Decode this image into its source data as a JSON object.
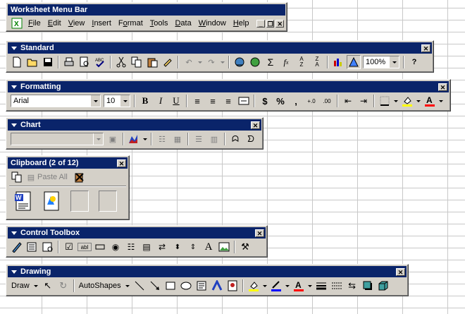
{
  "menu_bar": {
    "title": "Worksheet Menu Bar",
    "items": [
      "File",
      "Edit",
      "View",
      "Insert",
      "Format",
      "Tools",
      "Data",
      "Window",
      "Help"
    ],
    "mnemonics": [
      "F",
      "E",
      "V",
      "I",
      "o",
      "T",
      "D",
      "W",
      "H"
    ]
  },
  "standard": {
    "title": "Standard",
    "zoom": "100%"
  },
  "formatting": {
    "title": "Formatting",
    "font": "Arial",
    "size": "10"
  },
  "chart": {
    "title": "Chart"
  },
  "clipboard": {
    "title": "Clipboard (2 of 12)",
    "paste_all": "Paste All"
  },
  "control_toolbox": {
    "title": "Control Toolbox"
  },
  "drawing": {
    "title": "Drawing",
    "draw_label": "Draw",
    "autoshapes_label": "AutoShapes"
  },
  "colors": {
    "titlebar": "#0a246a",
    "face": "#d4d0c8",
    "fill_yellow": "#ffff00",
    "line_blue": "#0000ff",
    "font_red": "#ff0000"
  }
}
